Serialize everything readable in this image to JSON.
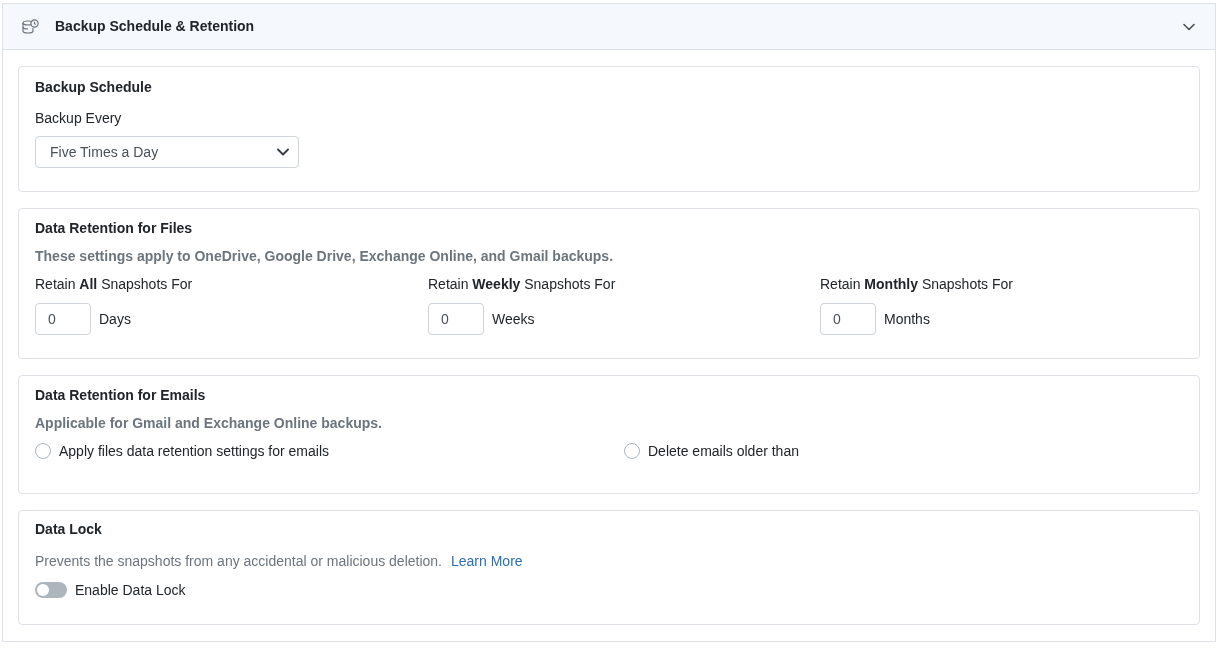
{
  "panel": {
    "title": "Backup Schedule & Retention",
    "expanded": true
  },
  "schedule": {
    "title": "Backup Schedule",
    "label": "Backup Every",
    "value": "Five Times a Day"
  },
  "file_retention": {
    "title": "Data Retention for Files",
    "note": "These settings apply to OneDrive, Google Drive, Exchange Online, and Gmail backups.",
    "fields": [
      {
        "label": "Retain **All** Snapshots For",
        "value": "0",
        "unit": "Days"
      },
      {
        "label": "Retain **Weekly** Snapshots For",
        "value": "0",
        "unit": "Weeks"
      },
      {
        "label": "Retain **Monthly** Snapshots For",
        "value": "0",
        "unit": "Months"
      }
    ]
  },
  "email_retention": {
    "title": "Data Retention for Emails",
    "note": "Applicable for Gmail and Exchange Online backups.",
    "options": [
      {
        "label": "Apply files data retention settings for emails",
        "selected": false
      },
      {
        "label": "Delete emails older than",
        "selected": false
      }
    ]
  },
  "data_lock": {
    "title": "Data Lock",
    "description": "Prevents the snapshots from any accidental or malicious deletion.",
    "link": "Learn More",
    "toggle": {
      "label": "Enable Data Lock",
      "on": false
    }
  }
}
